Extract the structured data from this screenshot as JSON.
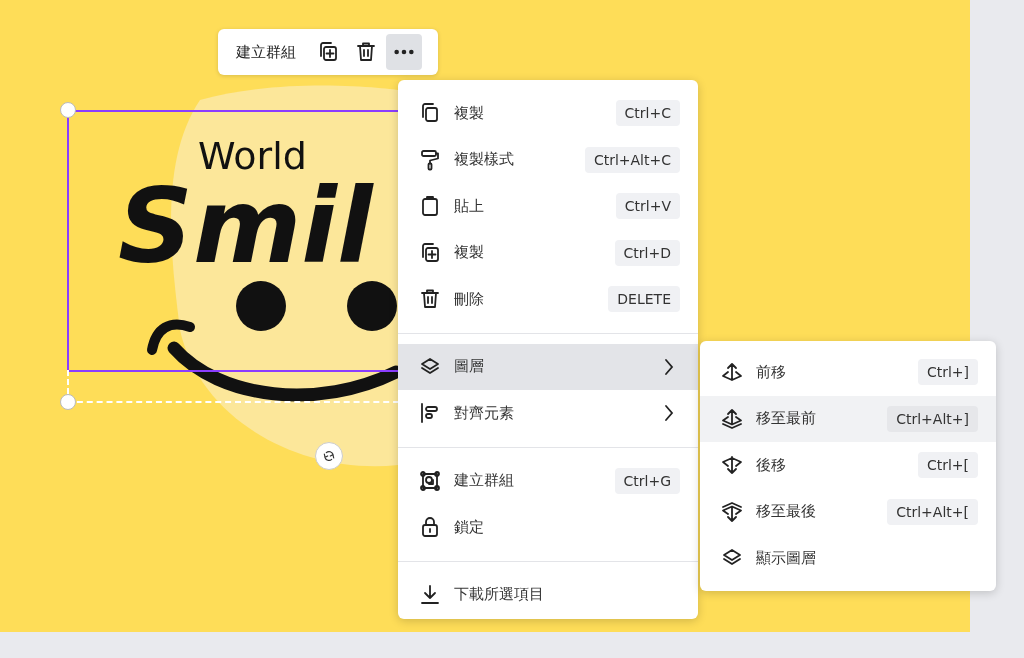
{
  "toolbar": {
    "label": "建立群組",
    "more_selected": true
  },
  "artwork": {
    "small_text": "World",
    "big_text": "Smil"
  },
  "context_menu": {
    "sections": [
      [
        {
          "kind": "copy",
          "label": "複製",
          "shortcut": "Ctrl+C",
          "selected": false,
          "submenu": false
        },
        {
          "kind": "roller",
          "label": "複製樣式",
          "shortcut": "Ctrl+Alt+C",
          "selected": false,
          "submenu": false
        },
        {
          "kind": "paste",
          "label": "貼上",
          "shortcut": "Ctrl+V",
          "selected": false,
          "submenu": false
        },
        {
          "kind": "duplicate",
          "label": "複製",
          "shortcut": "Ctrl+D",
          "selected": false,
          "submenu": false
        },
        {
          "kind": "trash",
          "label": "刪除",
          "shortcut": "DELETE",
          "selected": false,
          "submenu": false
        }
      ],
      [
        {
          "kind": "layers",
          "label": "圖層",
          "selected": true,
          "submenu": true
        },
        {
          "kind": "align",
          "label": "對齊元素",
          "selected": false,
          "submenu": true
        }
      ],
      [
        {
          "kind": "group",
          "label": "建立群組",
          "shortcut": "Ctrl+G",
          "selected": false,
          "submenu": false
        },
        {
          "kind": "lock",
          "label": "鎖定",
          "selected": false,
          "submenu": false
        }
      ],
      [
        {
          "kind": "download",
          "label": "下載所選項目",
          "selected": false,
          "submenu": false
        }
      ]
    ]
  },
  "layer_submenu": {
    "items": [
      {
        "kind": "forward",
        "label": "前移",
        "shortcut": "Ctrl+]",
        "selected": false
      },
      {
        "kind": "front",
        "label": "移至最前",
        "shortcut": "Ctrl+Alt+]",
        "selected": true
      },
      {
        "kind": "backward",
        "label": "後移",
        "shortcut": "Ctrl+[",
        "selected": false
      },
      {
        "kind": "back",
        "label": "移至最後",
        "shortcut": "Ctrl+Alt+[",
        "selected": false
      },
      {
        "kind": "layers",
        "label": "顯示圖層",
        "selected": false
      }
    ]
  }
}
